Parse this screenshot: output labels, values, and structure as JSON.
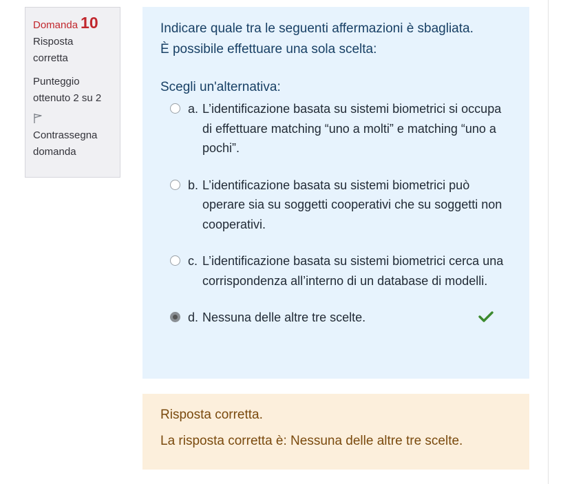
{
  "info": {
    "question_word": "Domanda",
    "question_number": "10",
    "state_line1": "Risposta",
    "state_line2": "corretta",
    "grade_line1": "Punteggio",
    "grade_line2": "ottenuto 2 su 2",
    "flag_icon": "flag-outline-icon",
    "flag_line1": "Contrassegna",
    "flag_line2": "domanda"
  },
  "question": {
    "text_line1": "Indicare quale tra le seguenti affermazioni è sbagliata.",
    "text_line2": "È possibile effettuare una sola scelta:",
    "prompt": "Scegli un'alternativa:",
    "options": [
      {
        "letter": "a.",
        "text": "L’identificazione basata su sistemi biometrici si occupa di effettuare matching “uno a molti” e matching “uno a pochi”.",
        "selected": false
      },
      {
        "letter": "b.",
        "text": "L’identificazione basata su sistemi biometrici può operare sia su soggetti cooperativi che su soggetti non cooperativi.",
        "selected": false
      },
      {
        "letter": "c.",
        "text": "L’identificazione basata su sistemi biometrici cerca una corrispondenza all’interno di un database di modelli.",
        "selected": false
      },
      {
        "letter": "d.",
        "text": "Nessuna delle altre tre scelte.",
        "selected": true,
        "mark_icon": "checkmark-icon"
      }
    ]
  },
  "feedback": {
    "line1": "Risposta corretta.",
    "line2": "La risposta corretta è: Nessuna delle altre tre scelte."
  },
  "colors": {
    "accent_red": "#c1272d",
    "question_bg": "#e7f3fd",
    "feedback_bg": "#fcefdc",
    "check_green": "#3c8a2e"
  }
}
